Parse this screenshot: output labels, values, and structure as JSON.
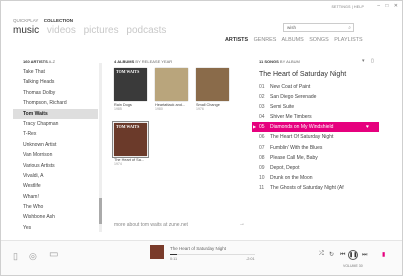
{
  "window": {
    "util_links": "SETTINGS | HELP",
    "controls": [
      "–",
      "□",
      "✕"
    ]
  },
  "nav": {
    "sub": [
      "QUICKPLAY",
      "COLLECTION"
    ],
    "main": [
      "music",
      "videos",
      "pictures",
      "podcasts"
    ]
  },
  "search": {
    "value": "wish"
  },
  "pivots": [
    "ARTISTS",
    "GENRES",
    "ALBUMS",
    "SONGS",
    "PLAYLISTS"
  ],
  "headers": {
    "artists": "160 ARTISTS",
    "artists_sort": "A-Z",
    "albums": "4 ALBUMS",
    "albums_sort": "BY RELEASE YEAR",
    "songs": "11 SONGS",
    "songs_sort": "BY ALBUM"
  },
  "artists": [
    "Take That",
    "Talking Heads",
    "Thomas Dolby",
    "Thompson, Richard",
    "Tom Waits",
    "Tracy Chapman",
    "T-Rex",
    "Unknown Artist",
    "Van Morrison",
    "Various Artists",
    "Vivaldi, A",
    "Westlife",
    "Wham!",
    "The Who",
    "Wishbone Ash",
    "Yes"
  ],
  "selected_artist": "Tom Waits",
  "albums": [
    {
      "name": "Rain Dogs",
      "year": "1985",
      "cover_text": "TOM WAITS",
      "color": "#3a3a3a"
    },
    {
      "name": "Heartattack and...",
      "year": "1980",
      "cover_text": "",
      "color": "#b9a57c"
    },
    {
      "name": "Small Change",
      "year": "1976",
      "cover_text": "",
      "color": "#8a6b4a"
    },
    {
      "name": "The Heart of Sa...",
      "year": "1974",
      "cover_text": "TOM WAITS",
      "color": "#6b3a2a"
    }
  ],
  "more_link": "more about tom waits at zune.net",
  "album_title": "The Heart of Saturday Night",
  "tracks": [
    {
      "num": "01",
      "title": "New Coat of Paint"
    },
    {
      "num": "02",
      "title": "San Diego Serenade"
    },
    {
      "num": "03",
      "title": "Semi Suite"
    },
    {
      "num": "04",
      "title": "Shiver Me Timbers"
    },
    {
      "num": "05",
      "title": "Diamonds on My Windshield",
      "playing": true
    },
    {
      "num": "06",
      "title": "The Heart Of Saturday Night"
    },
    {
      "num": "07",
      "title": "Fumblin' With the Blues"
    },
    {
      "num": "08",
      "title": "Please Call Me, Baby"
    },
    {
      "num": "09",
      "title": "Depot, Depot"
    },
    {
      "num": "10",
      "title": "Drunk on the Moon"
    },
    {
      "num": "11",
      "title": "The Ghosts of Saturday Night (Af"
    }
  ],
  "now_playing": {
    "title": "The Heart of Saturday Night",
    "elapsed": "0:11",
    "remaining": "-2:01",
    "progress": 0.08,
    "art_color": "#7a3b2a"
  },
  "volume_label": "VOLUME 30"
}
